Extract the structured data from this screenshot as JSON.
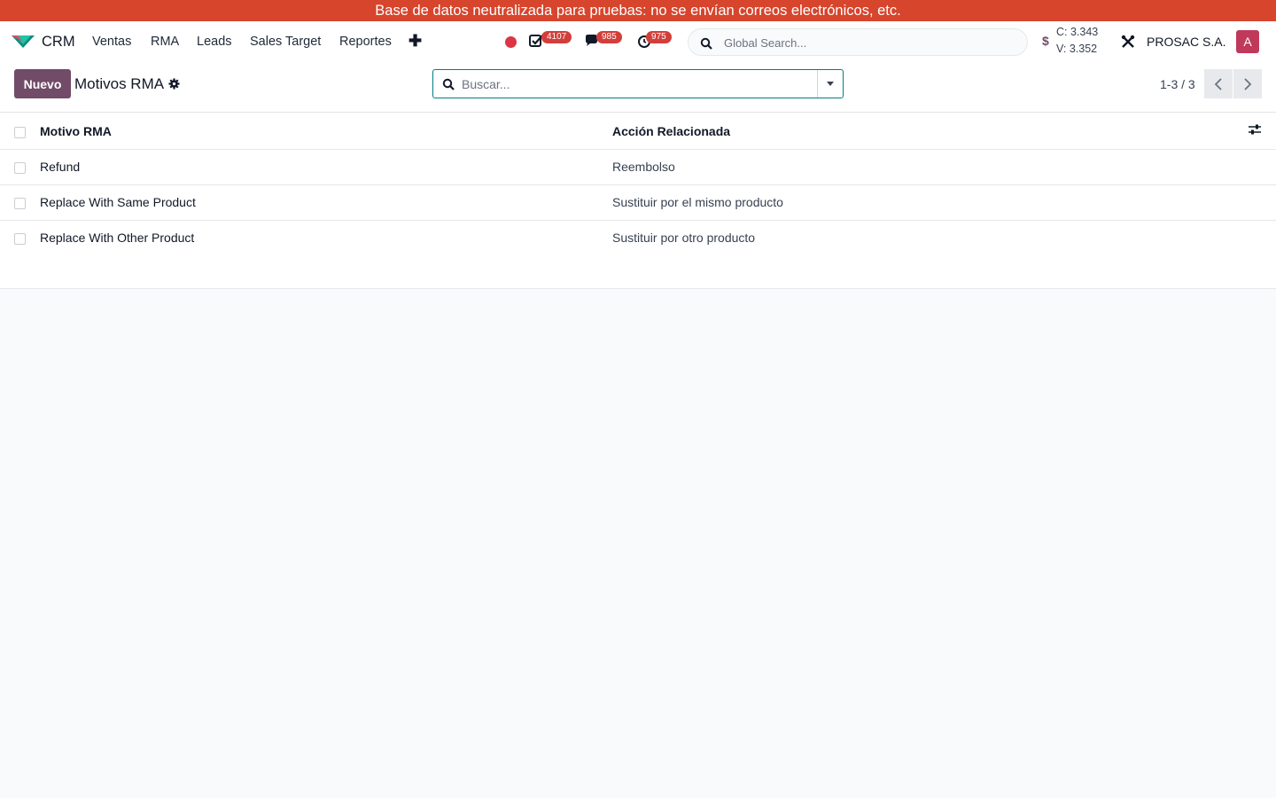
{
  "banner": {
    "text": "Base de datos neutralizada para pruebas: no se envían correos electrónicos, etc."
  },
  "navbar": {
    "app_name": "CRM",
    "menu": [
      "Ventas",
      "RMA",
      "Leads",
      "Sales Target",
      "Reportes"
    ],
    "add_icon": "plus-icon",
    "systray": {
      "recording_color": "#dc3545",
      "activities_icon": "checkbox-icon",
      "activities_count": "4107",
      "messages_icon": "chat-icon",
      "messages_count": "985",
      "timer_icon": "clock-icon",
      "timer_count": "975"
    },
    "global_search": {
      "placeholder": "Global Search..."
    },
    "currency": {
      "symbol": "$",
      "buy_rate": "C: 3.343",
      "sell_rate": "V: 3.352"
    },
    "tools_icon": "tools-icon",
    "company": "PROSAC S.A.",
    "user_initial": "A"
  },
  "control_panel": {
    "new_button": "Nuevo",
    "breadcrumb": "Motivos RMA",
    "gear_icon": "gear-icon",
    "search": {
      "placeholder": "Buscar..."
    },
    "pager": "1-3 / 3"
  },
  "list": {
    "headers": [
      "Motivo RMA",
      "Acción Relacionada"
    ],
    "rows": [
      {
        "reason": "Refund",
        "action": "Reembolso"
      },
      {
        "reason": "Replace With Same Product",
        "action": "Sustituir por el mismo producto"
      },
      {
        "reason": "Replace With Other Product",
        "action": "Sustituir por otro producto"
      }
    ]
  },
  "colors": {
    "banner": "#d6452c",
    "primary": "#714b67",
    "badge": "#d23f3a",
    "search_border": "#017e84"
  }
}
